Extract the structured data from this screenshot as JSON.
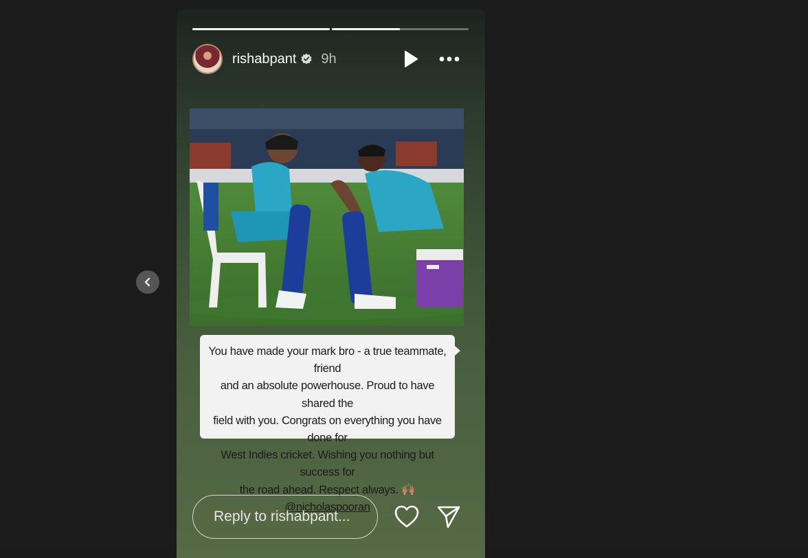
{
  "story": {
    "progress": [
      1.0,
      0.5
    ],
    "username": "rishabpant",
    "time_ago": "9h",
    "caption_lines": [
      "You have made your mark bro - a true teammate, friend",
      "and an absolute powerhouse. Proud to have shared the",
      "field with you. Congrats on everything you have done for",
      "West Indies cricket. Wishing you nothing but success for"
    ],
    "caption_last": "the road ahead. Respect always. 🙌🏽 ",
    "caption_mention": "@nicholaspooran",
    "reply_placeholder": "Reply to rishabpant..."
  },
  "icons": {
    "verified": "verified-badge-icon",
    "play": "play-icon",
    "more": "more-horizontal-icon",
    "like": "heart-icon",
    "send": "send-icon",
    "prev": "chevron-left-icon"
  },
  "colors": {
    "background": "#1b1b1b",
    "caption_bg": "#f2f2f2",
    "accent_white": "#ffffff"
  }
}
